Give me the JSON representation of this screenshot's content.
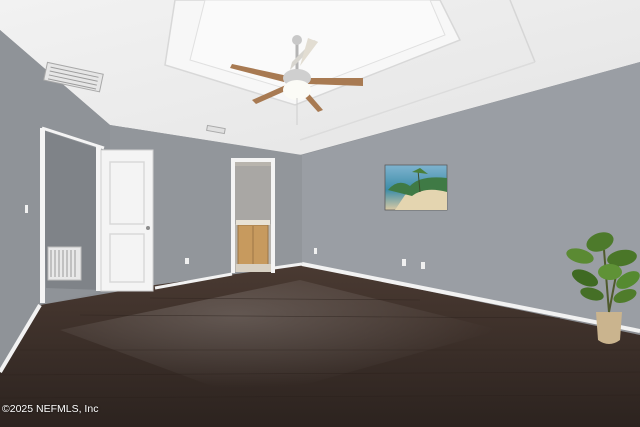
{
  "watermark": {
    "text": "©2025 NEFMLS, Inc"
  },
  "colors": {
    "wall_right": "#9a9ea4",
    "wall_left": "#8f9398",
    "ceiling": "#eeeeee",
    "floor": "#3a2e28",
    "baseboard": "#f2f2f2",
    "door": "#f4f4f4",
    "fan_blade": "#a87a52"
  },
  "icons": [
    "ceiling-fan-icon",
    "air-vent-icon",
    "painting-icon",
    "plant-icon",
    "door-icon",
    "outlet-icon"
  ]
}
